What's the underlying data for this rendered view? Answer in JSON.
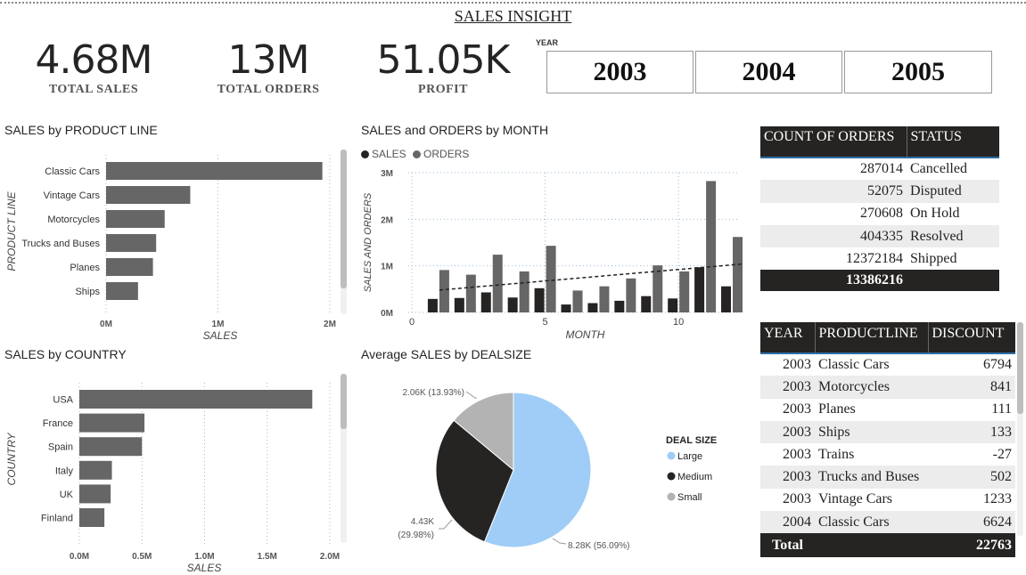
{
  "header": {
    "title": "SALES INSIGHT"
  },
  "kpis": [
    {
      "value": "4.68M",
      "label": "TOTAL SALES"
    },
    {
      "value": "13M",
      "label": "TOTAL ORDERS"
    },
    {
      "value": "51.05K",
      "label": "PROFIT"
    }
  ],
  "year_slicer": {
    "label": "YEAR",
    "options": [
      "2003",
      "2004",
      "2005"
    ]
  },
  "colors": {
    "bar": "#666666",
    "dark": "#252423",
    "large": "#9fcdf7",
    "medium": "#252423",
    "small": "#b3b3b3"
  },
  "product_line_chart": {
    "title": "SALES by PRODUCT LINE",
    "chart_data": {
      "type": "bar",
      "orientation": "horizontal",
      "categories": [
        "Classic Cars",
        "Vintage Cars",
        "Motorcycles",
        "Trucks and Buses",
        "Planes",
        "Ships"
      ],
      "values": [
        2.03,
        0.79,
        0.55,
        0.47,
        0.44,
        0.3
      ],
      "xlabel": "SALES",
      "ylabel": "PRODUCT LINE",
      "xticks": [
        "0M",
        "1M",
        "2M"
      ],
      "xlim": [
        0,
        2.1
      ],
      "unit": "M"
    }
  },
  "country_chart": {
    "title": "SALES by COUNTRY",
    "chart_data": {
      "type": "bar",
      "orientation": "horizontal",
      "categories": [
        "USA",
        "France",
        "Spain",
        "Italy",
        "UK",
        "Finland"
      ],
      "values": [
        1.86,
        0.52,
        0.5,
        0.26,
        0.25,
        0.2
      ],
      "xlabel": "SALES",
      "ylabel": "COUNTRY",
      "xticks": [
        "0.0M",
        "0.5M",
        "1.0M",
        "1.5M",
        "2.0M"
      ],
      "xlim": [
        0,
        2.0
      ],
      "unit": "M"
    }
  },
  "month_chart": {
    "title": "SALES and ORDERS by MONTH",
    "legend": [
      "SALES",
      "ORDERS"
    ],
    "chart_data": {
      "type": "bar",
      "x": [
        1,
        2,
        3,
        4,
        5,
        6,
        7,
        8,
        9,
        10,
        11,
        12
      ],
      "series": [
        {
          "name": "SALES",
          "values": [
            0.29,
            0.31,
            0.43,
            0.32,
            0.52,
            0.17,
            0.2,
            0.25,
            0.35,
            0.3,
            0.97,
            0.56
          ]
        },
        {
          "name": "ORDERS",
          "values": [
            0.91,
            0.81,
            1.24,
            0.88,
            1.43,
            0.47,
            0.56,
            0.73,
            1.01,
            0.88,
            2.82,
            1.62
          ]
        }
      ],
      "trendline": {
        "from": 0.48,
        "to": 1.04
      },
      "xlabel": "MONTH",
      "ylabel": "SALES AND ORDERS",
      "xticks": [
        "0",
        "5",
        "10"
      ],
      "yticks": [
        "0M",
        "1M",
        "2M",
        "3M"
      ],
      "ylim": [
        0,
        3
      ]
    }
  },
  "deal_chart": {
    "title": "Average SALES by DEALSIZE",
    "legend_title": "DEAL SIZE",
    "chart_data": {
      "type": "pie",
      "categories": [
        "Large",
        "Medium",
        "Small"
      ],
      "values": [
        56.09,
        29.98,
        13.93
      ],
      "labels": [
        "8.28K (56.09%)",
        "4.43K",
        "(29.98%)",
        "2.06K (13.93%)"
      ]
    }
  },
  "status_table": {
    "headers": [
      "COUNT OF ORDERS",
      "STATUS"
    ],
    "rows": [
      {
        "count": "287014",
        "status": "Cancelled"
      },
      {
        "count": "52075",
        "status": "Disputed"
      },
      {
        "count": "270608",
        "status": "On Hold"
      },
      {
        "count": "404335",
        "status": "Resolved"
      },
      {
        "count": "12372184",
        "status": "Shipped"
      }
    ],
    "total": "13386216"
  },
  "discount_table": {
    "headers": [
      "YEAR",
      "PRODUCTLINE",
      "DISCOUNT"
    ],
    "rows": [
      {
        "year": "2003",
        "line": "Classic Cars",
        "discount": "6794"
      },
      {
        "year": "2003",
        "line": "Motorcycles",
        "discount": "841"
      },
      {
        "year": "2003",
        "line": "Planes",
        "discount": "111"
      },
      {
        "year": "2003",
        "line": "Ships",
        "discount": "133"
      },
      {
        "year": "2003",
        "line": "Trains",
        "discount": "-27"
      },
      {
        "year": "2003",
        "line": "Trucks and Buses",
        "discount": "502"
      },
      {
        "year": "2003",
        "line": "Vintage Cars",
        "discount": "1233"
      },
      {
        "year": "2004",
        "line": "Classic Cars",
        "discount": "6624"
      }
    ],
    "total_label": "Total",
    "total": "22763"
  }
}
